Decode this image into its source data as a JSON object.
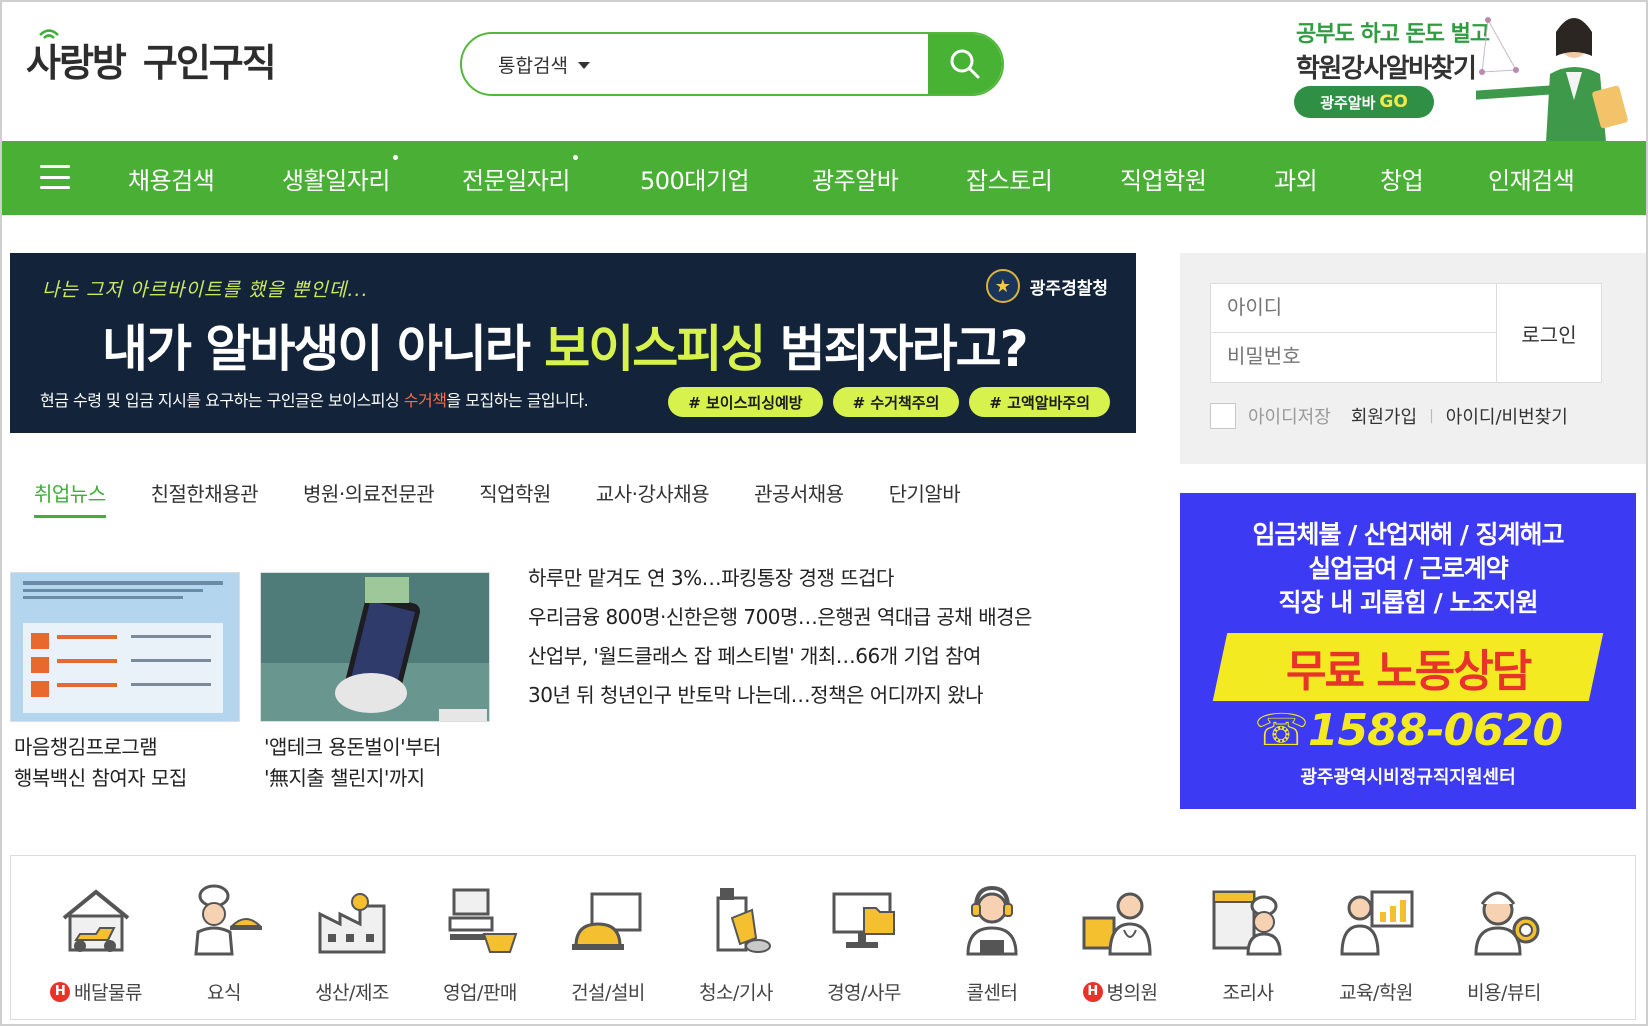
{
  "header": {
    "logo_part1": "사랑방",
    "logo_part2": "구인구직",
    "search": {
      "type_selected": "통합검색",
      "query": ""
    },
    "ad": {
      "line1": "공부도 하고 돈도 벌고",
      "line2": "학원강사알바찾기",
      "button_a": "광주알바",
      "button_b": "GO"
    }
  },
  "nav": {
    "items": [
      {
        "label": "채용검색"
      },
      {
        "label": "생활일자리"
      },
      {
        "label": "전문일자리"
      },
      {
        "label": "500대기업"
      },
      {
        "label": "광주알바"
      },
      {
        "label": "잡스토리"
      },
      {
        "label": "직업학원"
      },
      {
        "label": "과외"
      },
      {
        "label": "창업"
      },
      {
        "label": "인재검색"
      }
    ]
  },
  "banner": {
    "top_text": "나는 그저 아르바이트를 했을 뿐인데...",
    "headline_a": "내가 알바생이 아니라 ",
    "headline_hl": "보이스피싱",
    "headline_b": " 범죄자라고?",
    "sub_a": "현금 수령 및 입금 지시를 요구하는 구인글은 보이스피싱 ",
    "sub_red": "수거책",
    "sub_b": "을 모집하는 글입니다.",
    "agency": "광주경찰청",
    "tags": [
      "# 보이스피싱예방",
      "# 수거책주의",
      "# 고액알바주의"
    ]
  },
  "login": {
    "id_placeholder": "아이디",
    "pw_placeholder": "비밀번호",
    "login_label": "로그인",
    "save_id": "아이디저장",
    "join": "회원가입",
    "find": "아이디/비번찾기"
  },
  "tabs": [
    {
      "label": "취업뉴스",
      "active": true
    },
    {
      "label": "친절한채용관"
    },
    {
      "label": "병원·의료전문관"
    },
    {
      "label": "직업학원"
    },
    {
      "label": "교사·강사채용"
    },
    {
      "label": "관공서채용"
    },
    {
      "label": "단기알바"
    }
  ],
  "news": {
    "thumbs": [
      {
        "line1": "마음챙김프로그램",
        "line2": "행복백신 참여자 모집"
      },
      {
        "line1": "'앱테크 용돈벌이'부터",
        "line2": "'無지출 챌린지'까지"
      }
    ],
    "headlines": [
      "하루만 맡겨도 연 3%…파킹통장 경쟁 뜨겁다",
      "우리금융 800명·신한은행 700명…은행권 역대급 공채 배경은",
      "산업부, '월드클래스 잡 페스티벌' 개최…66개 기업 참여",
      "30년 뒤 청년인구 반토막 나는데…정책은 어디까지 왔나"
    ]
  },
  "right_ad": {
    "line1": "임금체불 / 산업재해 / 징계해고",
    "line2": "실업급여 / 근로계약",
    "line3": "직장 내 괴롭힘 / 노조지원",
    "free": "무료 노동상담",
    "phone": "☏1588-0620",
    "org": "광주광역시비정규직지원센터"
  },
  "categories": [
    {
      "label": "배달물류",
      "badge": "H",
      "icon": "delivery-icon"
    },
    {
      "label": "요식",
      "icon": "chef-icon"
    },
    {
      "label": "생산/제조",
      "icon": "factory-icon"
    },
    {
      "label": "영업/판매",
      "icon": "sales-icon"
    },
    {
      "label": "건설/설비",
      "icon": "construction-icon"
    },
    {
      "label": "청소/기사",
      "icon": "cleaning-icon"
    },
    {
      "label": "경영/사무",
      "icon": "office-icon"
    },
    {
      "label": "콜센터",
      "icon": "callcenter-icon"
    },
    {
      "label": "병의원",
      "badge": "H",
      "icon": "hospital-icon"
    },
    {
      "label": "조리사",
      "icon": "cook-icon"
    },
    {
      "label": "교육/학원",
      "icon": "education-icon"
    },
    {
      "label": "비용/뷰티",
      "icon": "beauty-icon"
    }
  ],
  "colors": {
    "brand_green": "#4ab035",
    "banner_bg": "#12233a",
    "banner_highlight": "#d8f24d",
    "ad_blue": "#3c3af2",
    "ad_yellow": "#f4ea22"
  }
}
